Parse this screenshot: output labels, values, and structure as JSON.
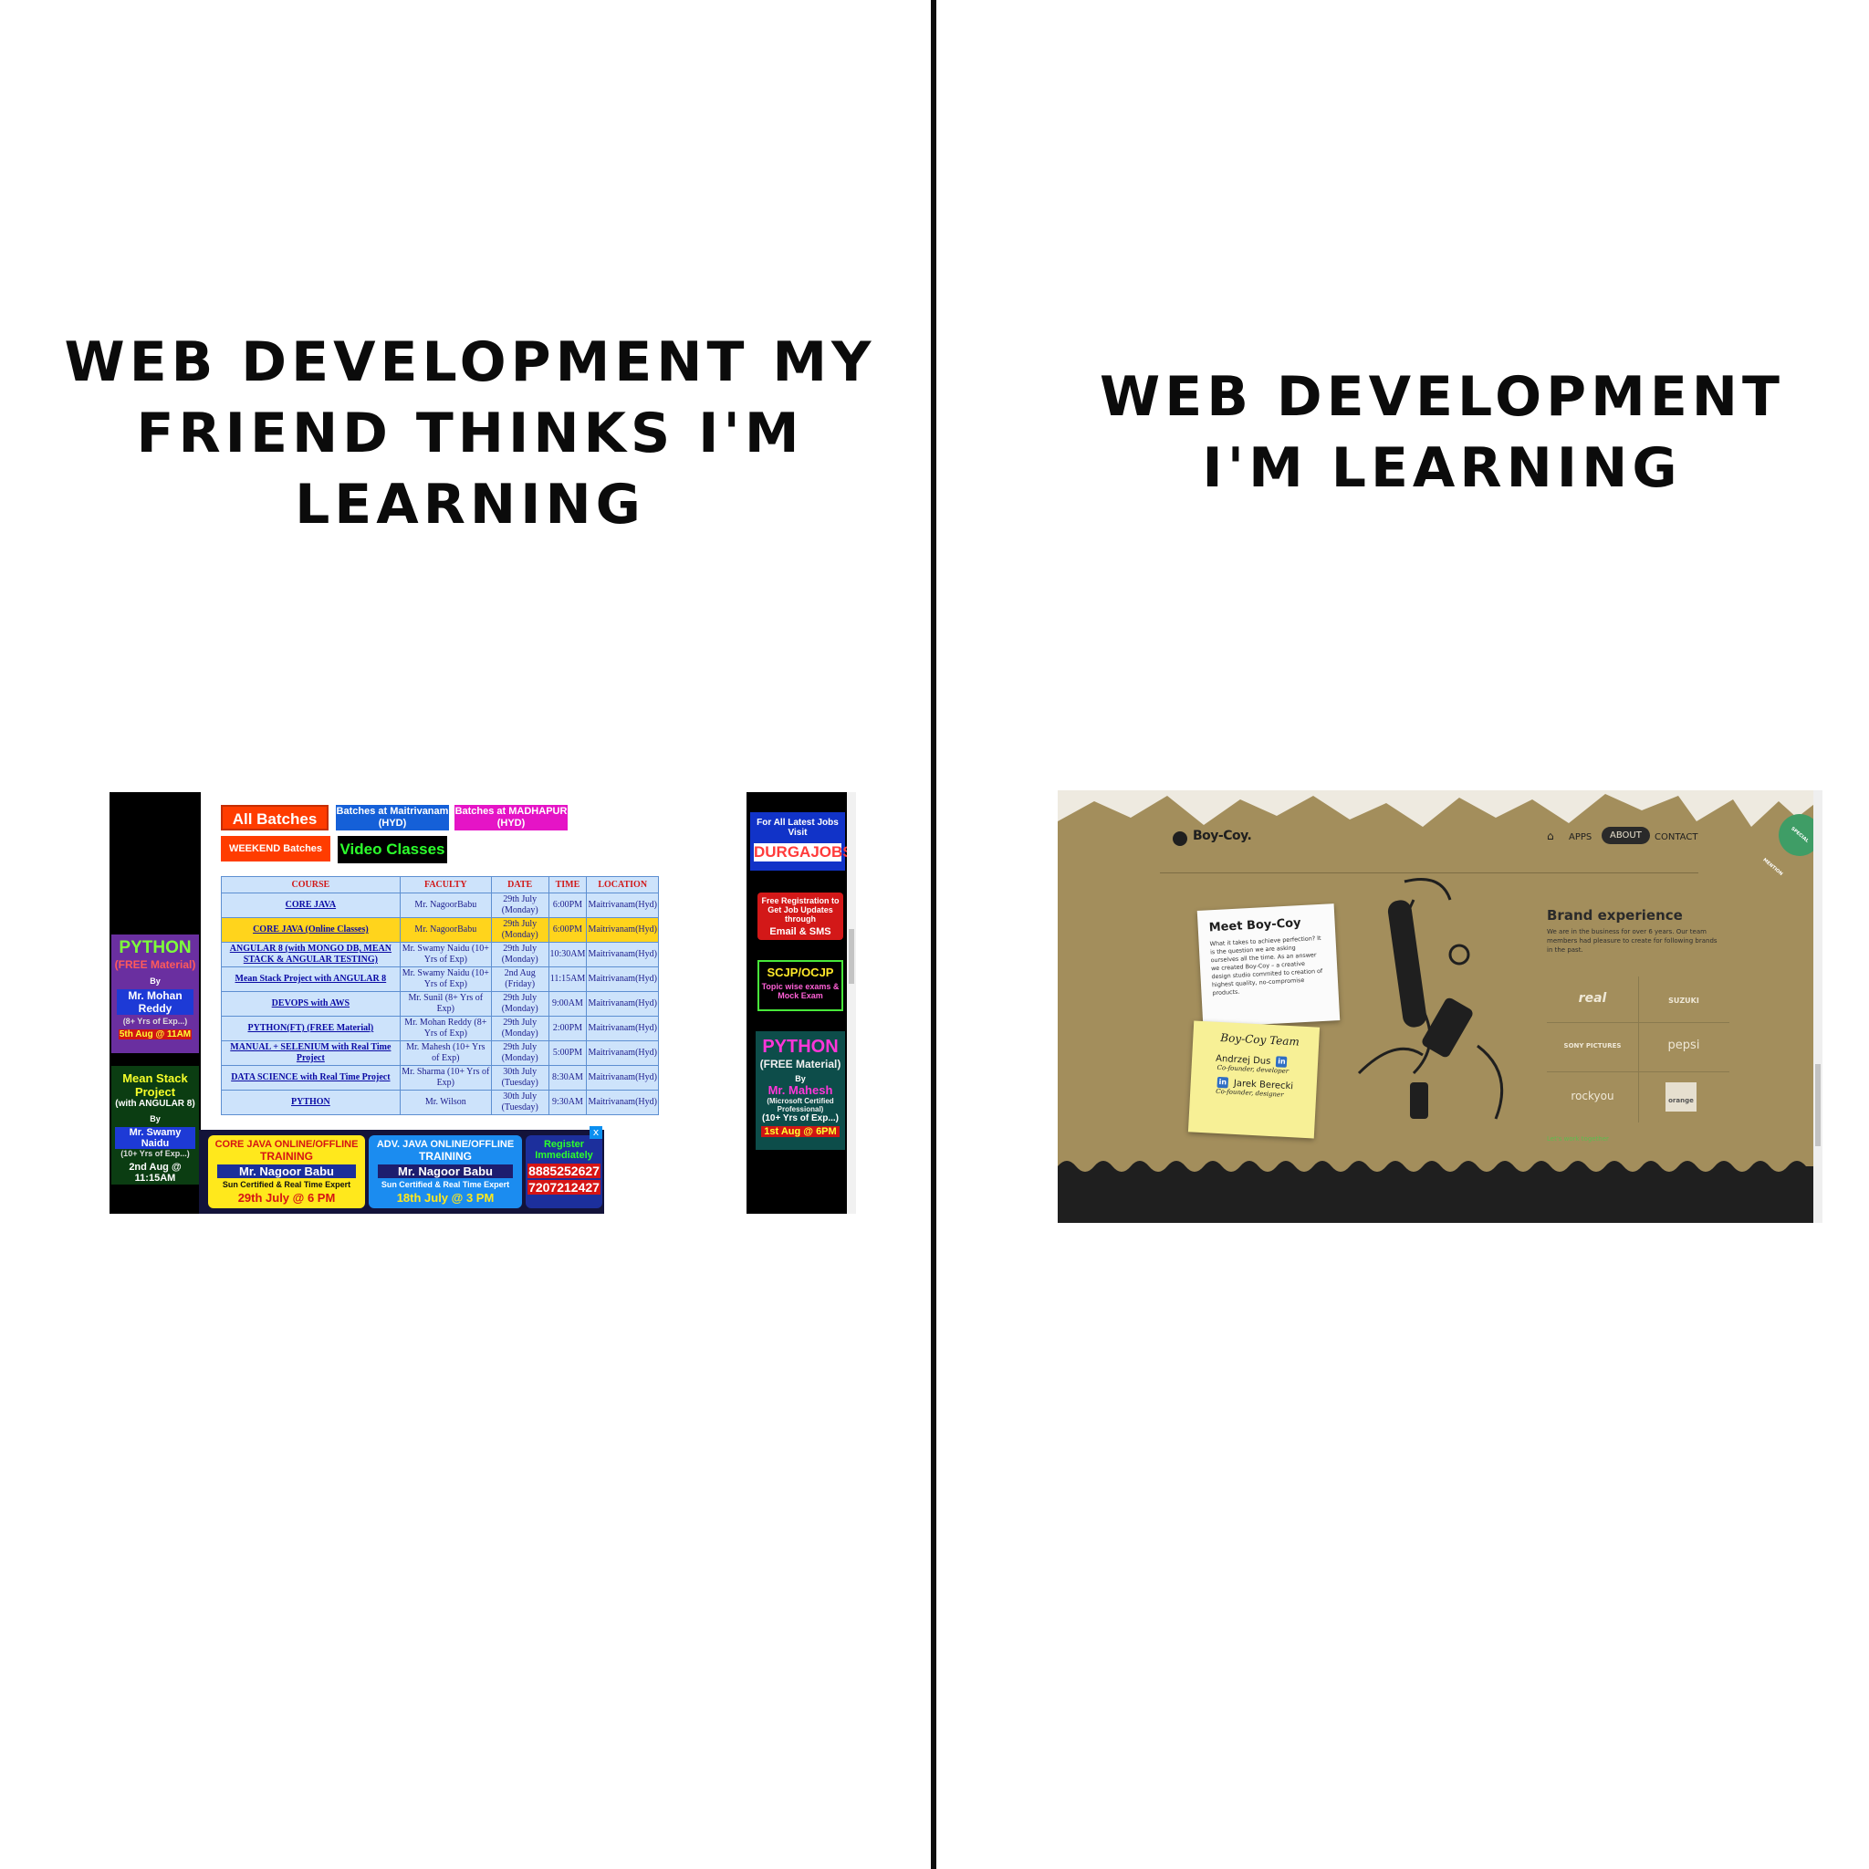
{
  "meme": {
    "left_caption": "WEB DEVELOPMENT MY FRIEND THINKS I'M LEARNING",
    "right_caption": "WEB DEVELOPMENT I'M LEARNING"
  },
  "left_site": {
    "nav": {
      "all_batches": "All Batches",
      "maitrivanam": "Batches at Maitrivanam (HYD)",
      "madhapur": "Batches at MADHAPUR (HYD)",
      "weekend": "WEEKEND Batches",
      "video": "Video Classes"
    },
    "table": {
      "headers": [
        "COURSE",
        "FACULTY",
        "DATE",
        "TIME",
        "LOCATION"
      ],
      "rows": [
        [
          "CORE JAVA",
          "Mr. NagoorBabu",
          "29th July (Monday)",
          "6:00PM",
          "Maitrivanam(Hyd)"
        ],
        [
          "CORE JAVA (Online Classes)",
          "Mr. NagoorBabu",
          "29th July (Monday)",
          "6:00PM",
          "Maitrivanam(Hyd)"
        ],
        [
          "ANGULAR 8 (with MONGO DB, MEAN STACK & ANGULAR TESTING)",
          "Mr. Swamy Naidu (10+ Yrs of Exp)",
          "29th July (Monday)",
          "10:30AM",
          "Maitrivanam(Hyd)"
        ],
        [
          "Mean Stack Project with ANGULAR 8",
          "Mr. Swamy Naidu (10+ Yrs of Exp)",
          "2nd Aug (Friday)",
          "11:15AM",
          "Maitrivanam(Hyd)"
        ],
        [
          "DEVOPS with AWS",
          "Mr. Sunil (8+ Yrs of Exp)",
          "29th July (Monday)",
          "9:00AM",
          "Maitrivanam(Hyd)"
        ],
        [
          "PYTHON(FT) (FREE Material)",
          "Mr. Mohan Reddy (8+ Yrs of Exp)",
          "29th July (Monday)",
          "2:00PM",
          "Maitrivanam(Hyd)"
        ],
        [
          "MANUAL + SELENIUM with Real Time Project",
          "Mr. Mahesh (10+ Yrs of Exp)",
          "29th July (Monday)",
          "5:00PM",
          "Maitrivanam(Hyd)"
        ],
        [
          "DATA SCIENCE with Real Time Project",
          "Mr. Sharma (10+ Yrs of Exp)",
          "30th July (Tuesday)",
          "8:30AM",
          "Maitrivanam(Hyd)"
        ],
        [
          "PYTHON",
          "Mr. Wilson",
          "30th July (Tuesday)",
          "9:30AM",
          "Maitrivanam(Hyd)"
        ]
      ],
      "hidden_location_suffix": "anam(Hyd)"
    },
    "ads": {
      "python_left": {
        "title": "PYTHON",
        "sub": "(FREE Material)",
        "by": "By",
        "name": "Mr. Mohan Reddy",
        "exp": "(8+ Yrs of Exp...)",
        "date": "5th Aug @ 11AM"
      },
      "mean_stack": {
        "title": "Mean Stack Project",
        "sub": "(with ANGULAR 8)",
        "by": "By",
        "name": "Mr. Swamy Naidu",
        "exp": "(10+ Yrs of Exp...)",
        "date": "2nd Aug @ 11:15AM"
      },
      "jobs": {
        "line1": "For All Latest Jobs Visit",
        "line2": "DURGAJOBS.COM"
      },
      "registration": {
        "line1": "Free Registration to Get Job Updates through",
        "line2": "Email & SMS"
      },
      "scjp": {
        "line1": "SCJP/OCJP",
        "line2": "Topic wise exams & Mock Exam"
      },
      "python_right": {
        "title": "PYTHON",
        "sub": "(FREE Material)",
        "by": "By",
        "name": "Mr. Mahesh",
        "cert": "(Microsoft Certified Professional)",
        "exp": "(10+ Yrs of Exp...)",
        "date": "1st Aug @ 6PM"
      },
      "bottom": {
        "core": {
          "line1": "CORE JAVA ONLINE/OFFLINE",
          "line2": "TRAINING",
          "name": "Mr. Nagoor Babu",
          "note": "Sun Certified & Real Time Expert",
          "date": "29th July @ 6 PM"
        },
        "adv": {
          "line1": "ADV. JAVA ONLINE/OFFLINE",
          "line2": "TRAINING",
          "name": "Mr. Nagoor Babu",
          "note": "Sun Certified & Real Time Expert",
          "date": "18th July @ 3 PM"
        },
        "register": {
          "line1": "Register Immediately",
          "phone1": "8885252627",
          "phone2": "7207212427"
        },
        "close": "x"
      }
    }
  },
  "right_site": {
    "logo": "Boy-Coy.",
    "nav": {
      "home_icon": "⌂",
      "apps": "APPS",
      "about": "ABOUT",
      "contact": "CONTACT"
    },
    "note": {
      "title": "Meet Boy-Coy",
      "body": "What it takes to achieve perfection? It is the question we are asking ourselves all the time. As an answer we created Boy-Coy – a creative design studio commited to creation of highest quality, no-compromise products."
    },
    "sticky": {
      "title": "Boy-Coy Team",
      "member1": "Andrzej Dus",
      "role1": "Co-founder, developer",
      "member2": "Jarek Berecki",
      "role2": "Co-founder, designer",
      "linkedin": "in"
    },
    "brand": {
      "title": "Brand experience",
      "body": "We are in the business for over 6 years. Our team members had pleasure to create for following brands in the past.",
      "logos": [
        "real",
        "SUZUKI",
        "SONY PICTURES",
        "pepsi",
        "rockyou",
        "orange"
      ],
      "cta": "Let's work together"
    },
    "badge": "SPECIAL MENTION",
    "colors": {
      "background": "#a38e5c",
      "dark": "#1f1f1f",
      "accent": "#5dbc4f"
    }
  }
}
